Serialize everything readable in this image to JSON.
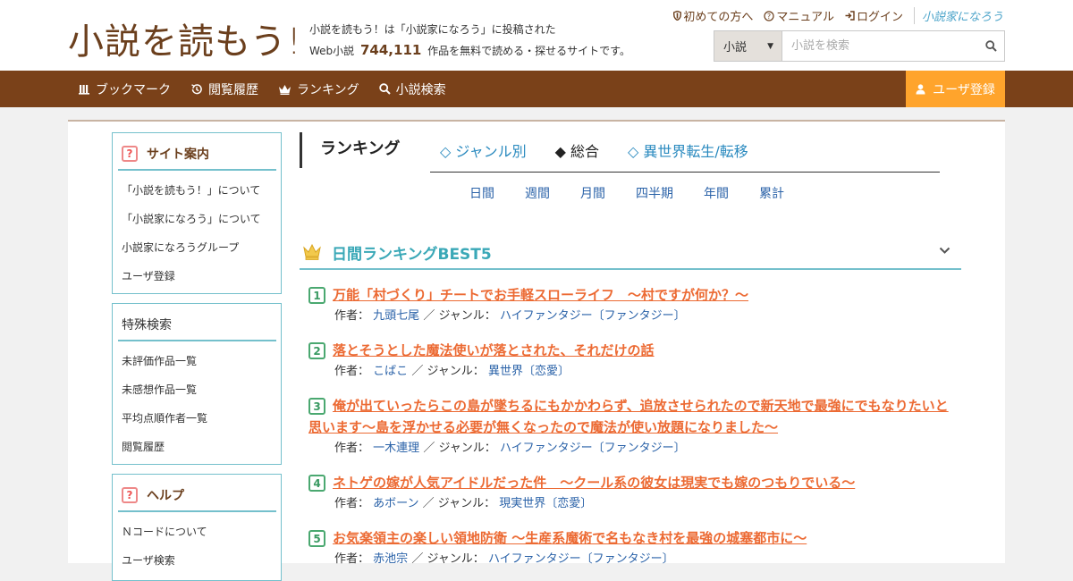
{
  "header": {
    "logo_text": "小説を読もう!",
    "tagline_line1": "小説を読もう！は「小説家になろう」に投稿された",
    "tagline_prefix": "Web小説",
    "novel_count": "744,111",
    "tagline_suffix": "作品を無料で読める・探せるサイトです。",
    "links": {
      "first_time": "初めての方へ",
      "manual": "マニュアル",
      "login": "ログイン",
      "narou": "小説家になろう"
    },
    "search": {
      "type_selected": "小説",
      "placeholder": "小説を検索"
    }
  },
  "nav": {
    "bookmark": "ブックマーク",
    "history": "閲覧履歴",
    "ranking": "ランキング",
    "search": "小説検索",
    "register": "ユーザ登録"
  },
  "sidebar": {
    "site_guide": {
      "title": "サイト案内",
      "items": [
        "「小説を読もう！」について",
        "「小説家になろう」について",
        "小説家になろうグループ",
        "ユーザ登録"
      ]
    },
    "special_search": {
      "title": "特殊検索",
      "items": [
        "未評価作品一覧",
        "未感想作品一覧",
        "平均点順作者一覧",
        "閲覧履歴"
      ]
    },
    "help": {
      "title": "ヘルプ",
      "items": [
        "Ｎコードについて",
        "ユーザ検索"
      ]
    }
  },
  "main": {
    "heading": "ランキング",
    "tabs": [
      "◇ ジャンル別",
      "◆ 総合",
      "◇ 異世界転生/転移"
    ],
    "periods": [
      "日間",
      "週間",
      "月間",
      "四半期",
      "年間",
      "累計"
    ],
    "best_title": "日間ランキングBEST5",
    "author_label": "作者：",
    "genre_label": "／ ジャンル：",
    "entries": [
      {
        "rank": "1",
        "title": "万能「村づくり」チートでお手軽スローライフ　～村ですが何か？～",
        "author": "九頭七尾",
        "genre": "ハイファンタジー〔ファンタジー〕"
      },
      {
        "rank": "2",
        "title": "落とそうとした魔法使いが落とされた、それだけの話",
        "author": "こばこ",
        "genre": "異世界〔恋愛〕"
      },
      {
        "rank": "3",
        "title": "俺が出ていったらこの島が墜ちるにもかかわらず、追放させられたので新天地で最強にでもなりたいと思います～島を浮かせる必要が無くなったので魔法が使い放題になりました～",
        "author": "一木連理",
        "genre": "ハイファンタジー〔ファンタジー〕"
      },
      {
        "rank": "4",
        "title": "ネトゲの嫁が人気アイドルだった件　～クール系の彼女は現実でも嫁のつもりでいる～",
        "author": "あボーン",
        "genre": "現実世界〔恋愛〕"
      },
      {
        "rank": "5",
        "title": "お気楽領主の楽しい領地防衛 〜生産系魔術で名もなき村を最強の城塞都市に〜",
        "author": "赤池宗",
        "genre": "ハイファンタジー〔ファンタジー〕"
      }
    ]
  },
  "colors": {
    "brand_brown": "#7a4119",
    "accent_orange": "#ffa42c",
    "teal": "#74c0cc",
    "title_orange": "#ec6a33",
    "link_blue": "#2a62a8"
  }
}
